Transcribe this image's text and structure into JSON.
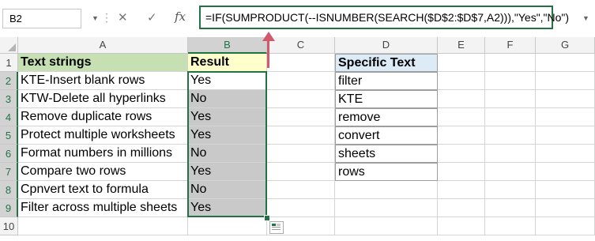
{
  "formula_bar": {
    "name_box": "B2",
    "formula": "=IF(SUMPRODUCT(--ISNUMBER(SEARCH($D$2:$D$7,A2))),\"Yes\",\"No\")",
    "cancel_glyph": "✕",
    "enter_glyph": "✓",
    "fx_glyph": "fx"
  },
  "columns": [
    "A",
    "B",
    "C",
    "D",
    "E",
    "F",
    "G"
  ],
  "rows": [
    "1",
    "2",
    "3",
    "4",
    "5",
    "6",
    "7",
    "8",
    "9",
    "10"
  ],
  "table": {
    "header_text": "Text strings",
    "header_result": "Result",
    "rows": [
      {
        "text": "KTE-Insert blank rows",
        "result": "Yes"
      },
      {
        "text": "KTW-Delete all hyperlinks",
        "result": "No"
      },
      {
        "text": "Remove duplicate rows",
        "result": "Yes"
      },
      {
        "text": "Protect multiple worksheets",
        "result": "Yes"
      },
      {
        "text": "Format numbers in millions",
        "result": "No"
      },
      {
        "text": "Compare two rows",
        "result": "Yes"
      },
      {
        "text": "Cpnvert text to formula",
        "result": "No"
      },
      {
        "text": "Filter across multiple sheets",
        "result": "Yes"
      }
    ]
  },
  "specific": {
    "header": "Specific Text",
    "items": [
      "filter",
      "KTE",
      "remove",
      "convert",
      "sheets",
      "rows"
    ]
  },
  "colors": {
    "accent": "#217346",
    "header_green": "#c6e0b4",
    "header_yellow": "#ffffcc",
    "header_blue": "#ddebf7",
    "selection_grey": "#c9c9c9",
    "arrow": "#d05a6a"
  }
}
